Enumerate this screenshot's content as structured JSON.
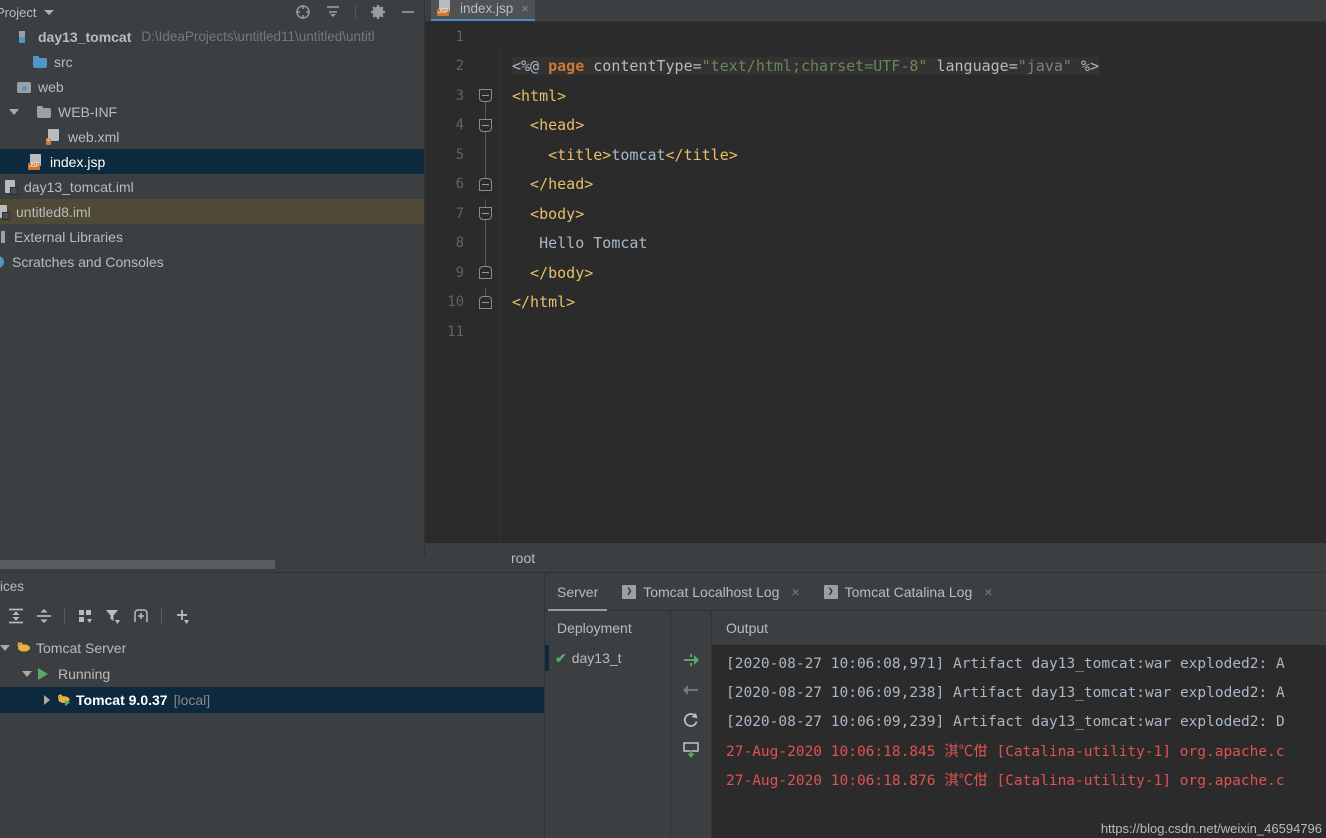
{
  "project_panel": {
    "title": "Project",
    "header_icons": [
      "locate-icon",
      "collapse-all-icon",
      "gear-icon",
      "minimize-icon"
    ],
    "tree": [
      {
        "label": "day13_tomcat",
        "path": "D:\\IdeaProjects\\untitled11\\untitled\\untitl",
        "icon": "project-root-icon",
        "bold": true,
        "state": "none",
        "indent": 0,
        "highlight": "none"
      },
      {
        "label": "src",
        "icon": "folder-icon",
        "bold": false,
        "state": "none",
        "indent": 1,
        "highlight": "none"
      },
      {
        "label": "web",
        "icon": "web-folder-icon",
        "bold": false,
        "state": "none",
        "indent": 1,
        "highlight": "none"
      },
      {
        "label": "WEB-INF",
        "icon": "folder-grey-icon",
        "bold": false,
        "state": "open",
        "indent": 1,
        "highlight": "none"
      },
      {
        "label": "web.xml",
        "icon": "xml-file-icon",
        "badge": "<",
        "bold": false,
        "state": "none",
        "indent": 3,
        "highlight": "none"
      },
      {
        "label": "index.jsp",
        "icon": "jsp-file-icon",
        "badge": "JSP",
        "bold": false,
        "state": "none",
        "indent": 2,
        "highlight": "selected"
      },
      {
        "label": "day13_tomcat.iml",
        "icon": "module-file-icon",
        "bold": false,
        "state": "none",
        "indent": 1,
        "highlight": "none"
      },
      {
        "label": "untitled8.iml",
        "icon": "module-file-icon",
        "bold": false,
        "state": "none",
        "indent": 0,
        "highlight": "amber"
      },
      {
        "label": "External Libraries",
        "icon": "library-icon",
        "bold": false,
        "state": "none",
        "indent": 0,
        "highlight": "none"
      },
      {
        "label": "Scratches and Consoles",
        "icon": "scratches-icon",
        "bold": false,
        "state": "none",
        "indent": 0,
        "highlight": "none"
      }
    ]
  },
  "editor": {
    "tab": {
      "label": "index.jsp",
      "icon": "jsp-file-icon",
      "badge": "JSP",
      "close": "×"
    },
    "breadcrumb": "root",
    "lines": [
      {
        "n": "1",
        "fold": "none",
        "highlight": false,
        "tokens": []
      },
      {
        "n": "2",
        "fold": "none",
        "highlight": true,
        "tokens": [
          {
            "t": "<%@ ",
            "c": "t-jspdelim"
          },
          {
            "t": "page",
            "c": "t-kw"
          },
          {
            "t": " contentType=",
            "c": "t-attr"
          },
          {
            "t": "\"text/html;charset=UTF-8\"",
            "c": "t-str"
          },
          {
            "t": " language=",
            "c": "t-attr"
          },
          {
            "t": "\"java\"",
            "c": "t-grey"
          },
          {
            "t": " %>",
            "c": "t-jspdelim"
          }
        ]
      },
      {
        "n": "3",
        "fold": "down",
        "highlight": false,
        "indent": 0,
        "tokens": [
          {
            "t": "<html>",
            "c": "t-tag"
          }
        ]
      },
      {
        "n": "4",
        "fold": "down",
        "highlight": false,
        "indent": 1,
        "tokens": [
          {
            "t": "  <head>",
            "c": "t-tag"
          }
        ]
      },
      {
        "n": "5",
        "fold": "line",
        "highlight": false,
        "indent": 2,
        "tokens": [
          {
            "t": "    <title>",
            "c": "t-tag"
          },
          {
            "t": "tomcat",
            "c": "t-plain"
          },
          {
            "t": "</title>",
            "c": "t-tag"
          }
        ]
      },
      {
        "n": "6",
        "fold": "up",
        "highlight": false,
        "indent": 1,
        "tokens": [
          {
            "t": "  </head>",
            "c": "t-tag"
          }
        ]
      },
      {
        "n": "7",
        "fold": "down",
        "highlight": false,
        "indent": 1,
        "tokens": [
          {
            "t": "  <body>",
            "c": "t-tag"
          }
        ]
      },
      {
        "n": "8",
        "fold": "line",
        "highlight": false,
        "indent": 2,
        "tokens": [
          {
            "t": "   Hello Tomcat",
            "c": "t-plain"
          }
        ]
      },
      {
        "n": "9",
        "fold": "up",
        "highlight": false,
        "indent": 1,
        "tokens": [
          {
            "t": "  </body>",
            "c": "t-tag"
          }
        ]
      },
      {
        "n": "10",
        "fold": "up",
        "highlight": false,
        "indent": 0,
        "tokens": [
          {
            "t": "</html>",
            "c": "t-tag"
          }
        ]
      },
      {
        "n": "11",
        "fold": "none",
        "highlight": false,
        "tokens": []
      }
    ]
  },
  "services": {
    "title": "ices",
    "toolbar_icons": [
      "expand-all-icon",
      "collapse-all-icon",
      "group-by-icon",
      "filter-icon",
      "add-tab-icon",
      "add-icon"
    ],
    "tree": [
      {
        "label": "Tomcat Server",
        "icon": "tomcat-icon",
        "state": "open",
        "indent": 1,
        "selected": false,
        "bold": false
      },
      {
        "label": "Running",
        "icon": "run-icon",
        "state": "open",
        "indent": 2,
        "selected": false,
        "bold": false
      },
      {
        "label": "Tomcat 9.0.37",
        "sub": "[local]",
        "icon": "tomcat-run-icon",
        "state": "closed",
        "indent": 3,
        "selected": true,
        "bold": true
      }
    ]
  },
  "console": {
    "tabs": [
      {
        "label": "Server",
        "icon": null,
        "active": true,
        "closable": false
      },
      {
        "label": "Tomcat Localhost Log",
        "icon": "console-icon",
        "active": false,
        "closable": true,
        "close": "×"
      },
      {
        "label": "Tomcat Catalina Log",
        "icon": "console-icon",
        "active": false,
        "closable": true,
        "close": "×"
      }
    ],
    "deployment": {
      "header": "Deployment",
      "item": "day13_t",
      "check": "✔"
    },
    "deploy_actions": [
      "redeploy-icon",
      "undeploy-icon",
      "restart-icon",
      "update-icon"
    ],
    "output": {
      "header": "Output",
      "lines": [
        {
          "text": "[2020-08-27 10:06:08,971] Artifact day13_tomcat:war exploded2: A",
          "level": "info"
        },
        {
          "text": "[2020-08-27 10:06:09,238] Artifact day13_tomcat:war exploded2: A",
          "level": "info"
        },
        {
          "text": "[2020-08-27 10:06:09,239] Artifact day13_tomcat:war exploded2: D",
          "level": "info"
        },
        {
          "text": "27-Aug-2020 10:06:18.845 淇℃佄 [Catalina-utility-1] org.apache.c",
          "level": "error"
        },
        {
          "text": "27-Aug-2020 10:06:18.876 淇℃佄 [Catalina-utility-1] org.apache.c",
          "level": "error"
        }
      ]
    }
  },
  "watermark": "https://blog.csdn.net/weixin_46594796",
  "colors": {
    "panel_bg": "#3c3f41",
    "editor_bg": "#2b2b2b",
    "selection_blue": "#0d293e",
    "highlight_amber": "#4e4a36",
    "accent_blue": "#4a88c7",
    "error_red": "#e05252",
    "green": "#59a869",
    "orange": "#cc7832",
    "string_green": "#6a8759",
    "tag_yellow": "#e8bf6a"
  }
}
